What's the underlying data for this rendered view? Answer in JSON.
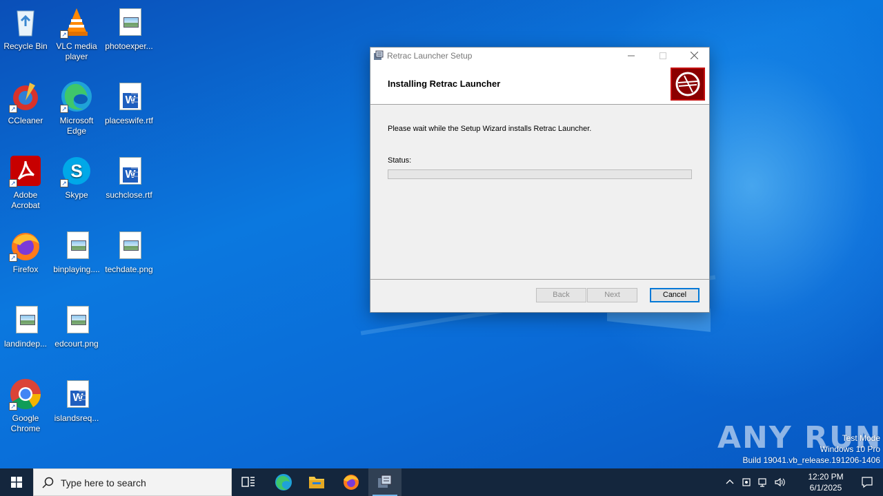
{
  "desktop": {
    "icons": [
      {
        "label": "Recycle Bin"
      },
      {
        "label": "VLC media player"
      },
      {
        "label": "photoexper..."
      },
      {
        "label": "CCleaner"
      },
      {
        "label": "Microsoft Edge"
      },
      {
        "label": "placeswife.rtf"
      },
      {
        "label": "Adobe Acrobat"
      },
      {
        "label": "Skype"
      },
      {
        "label": "suchclose.rtf"
      },
      {
        "label": "Firefox"
      },
      {
        "label": "binplaying...."
      },
      {
        "label": "techdate.png"
      },
      {
        "label": "landindep..."
      },
      {
        "label": "edcourt.png"
      },
      {
        "label": "Google Chrome"
      },
      {
        "label": "islandsreq..."
      }
    ]
  },
  "installer": {
    "window_title": "Retrac Launcher Setup",
    "header_title": "Installing Retrac Launcher",
    "message": "Please wait while the Setup Wizard installs Retrac Launcher.",
    "status_label": "Status:",
    "progress": 0,
    "buttons": {
      "back": "Back",
      "next": "Next",
      "cancel": "Cancel"
    }
  },
  "watermark": {
    "brand": "ANY RUN",
    "line1": "Test Mode",
    "line2": "Windows 10 Pro",
    "line3": "Build 19041.vb_release.191206-1406"
  },
  "taskbar": {
    "search_placeholder": "Type here to search",
    "time": "12:20 PM",
    "date": "6/1/2025"
  },
  "colors": {
    "taskbar": "#14263d",
    "accent": "#0078d7",
    "banner": "#8b0000"
  }
}
